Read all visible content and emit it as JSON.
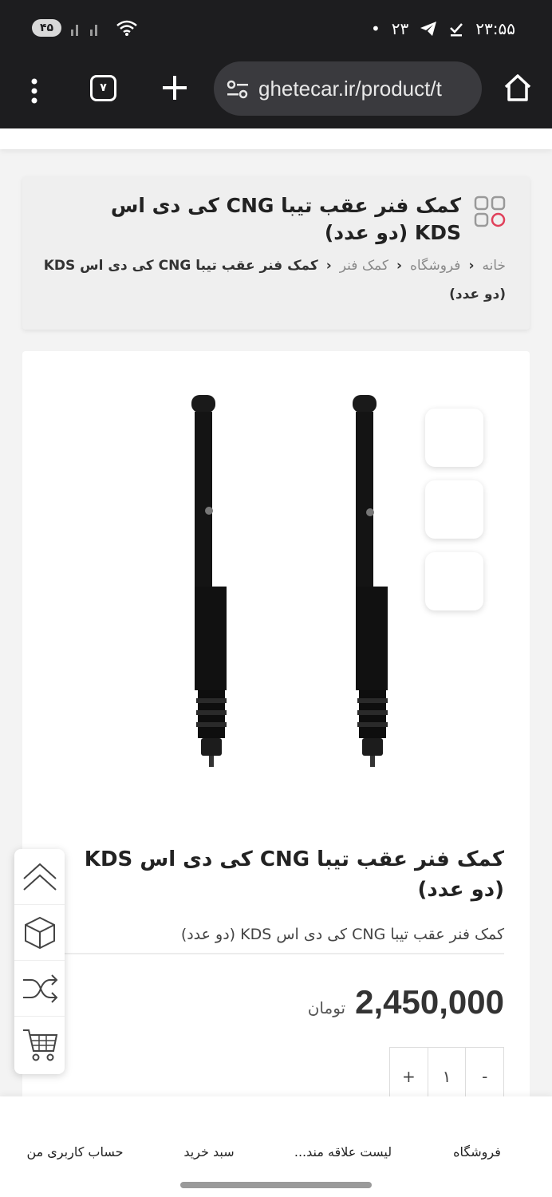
{
  "status_bar": {
    "time": "۲۳:۵۵",
    "notif_count": "۲۳",
    "battery": "۴۵"
  },
  "browser": {
    "url": "ghetecar.ir/product/t",
    "tab_count": "۷"
  },
  "header": {
    "title": "کمک فنر عقب تیبا CNG کی دی اس KDS (دو عدد)",
    "breadcrumb": {
      "home": "خانه",
      "shop": "فروشگاه",
      "category": "کمک فنر",
      "current": "کمک فنر عقب تیبا CNG کی دی اس KDS (دو عدد)"
    }
  },
  "product": {
    "title": "کمک فنر عقب تیبا CNG کی دی اس KDS (دو عدد)",
    "subtitle": "کمک فنر عقب تیبا CNG کی دی اس KDS (دو عدد)",
    "price": "2,450,000",
    "currency": "تومان",
    "quantity": "۱",
    "qty_plus": "+",
    "qty_minus": "-",
    "thumb_icons": [
      "",
      "",
      ""
    ]
  },
  "bottom_nav": {
    "items": [
      {
        "label": "فروشگاه",
        "icon": ""
      },
      {
        "label": "لیست علاقه مند...",
        "icon": ""
      },
      {
        "label": "سبد خرید",
        "icon": ""
      },
      {
        "label": "حساب کاربری من",
        "icon": ""
      }
    ]
  },
  "colors": {
    "dark_bar": "#1d1d1f",
    "accent_red": "#e0405a",
    "page_bg": "#f3f3f3"
  }
}
